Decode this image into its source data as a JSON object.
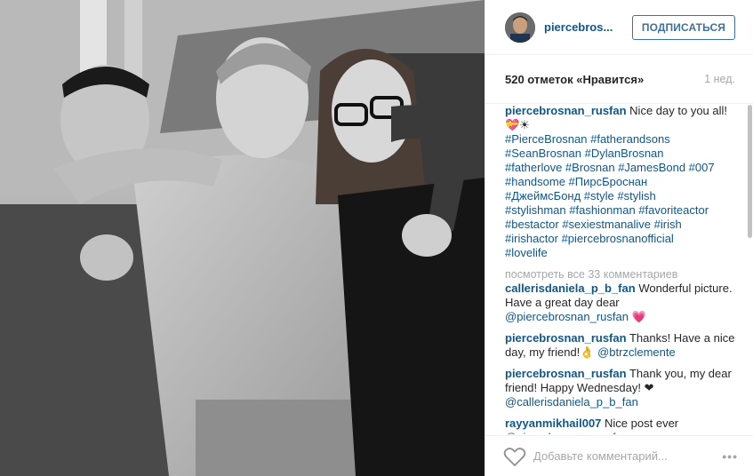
{
  "post": {
    "username": "piercebros...",
    "follow_label": "ПОДПИСАТЬСЯ",
    "likes": "520 отметок «Нравится»",
    "time": "1 нед."
  },
  "caption": {
    "user": "piercebrosnan_rusfan",
    "text": "Nice day to you all!💝☀",
    "tags_lines": [
      "#PierceBrosnan #fatherandsons",
      "#SeanBrosnan #DylanBrosnan",
      "#fatherlove #Brosnan #JamesBond #007",
      "#handsome #ПирсБроснан",
      "#ДжеймсБонд #style #stylish",
      "#stylishman #fashionman #favoriteactor",
      "#bestactor #sexiestmanalive #irish",
      "#irishactor #piercebrosnanofficial",
      "#lovelife"
    ]
  },
  "view_all": "посмотреть все 33 комментариев",
  "comments": [
    {
      "user": "callerisdaniela_p_b_fan",
      "text": "Wonderful picture. Have a great day dear",
      "mention": "@piercebrosnan_rusfan",
      "suffix": " 💗"
    },
    {
      "user": "piercebrosnan_rusfan",
      "text": "Thanks! Have a nice day, my friend!👌",
      "mention": "@btrzclemente",
      "suffix": ""
    },
    {
      "user": "piercebrosnan_rusfan",
      "text": "Thank you, my dear friend! Happy Wednesday! ❤",
      "mention": "@callerisdaniela_p_b_fan",
      "suffix": ""
    },
    {
      "user": "rayyanmikhail007",
      "text": "Nice post ever",
      "mention": "@piercebrosnan_rusfan",
      "suffix": ""
    }
  ],
  "footer": {
    "placeholder": "Добавьте комментарий...",
    "more": "•••",
    "heart_icon": "heart-outline-icon"
  },
  "colors": {
    "link": "#125688",
    "follow_border": "#3f729b",
    "muted": "#a5a7aa"
  }
}
